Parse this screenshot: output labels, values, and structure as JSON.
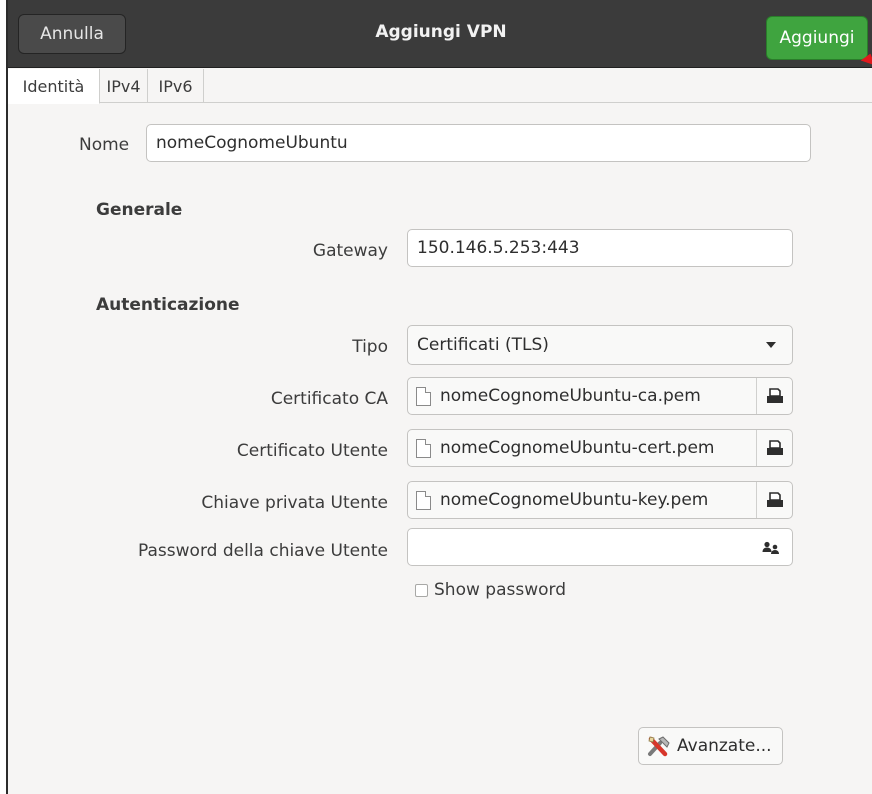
{
  "header": {
    "cancel_label": "Annulla",
    "title": "Aggiungi VPN",
    "add_label": "Aggiungi"
  },
  "tabs": [
    {
      "label": "Identità",
      "active": true
    },
    {
      "label": "IPv4",
      "active": false
    },
    {
      "label": "IPv6",
      "active": false
    }
  ],
  "identity": {
    "name_label": "Nome",
    "name_value": "nomeCognomeUbuntu"
  },
  "general": {
    "heading": "Generale",
    "gateway_label": "Gateway",
    "gateway_value": "150.146.5.253:443"
  },
  "auth": {
    "heading": "Autenticazione",
    "type_label": "Tipo",
    "type_value": "Certificati (TLS)",
    "ca_label": "Certificato CA",
    "ca_value": "nomeCognomeUbuntu-ca.pem",
    "user_cert_label": "Certificato Utente",
    "user_cert_value": "nomeCognomeUbuntu-cert.pem",
    "key_label": "Chiave privata Utente",
    "key_value": "nomeCognomeUbuntu-key.pem",
    "key_password_label": "Password della chiave Utente",
    "key_password_value": "",
    "show_password_label": "Show password",
    "show_password_checked": false
  },
  "advanced_label": "Avanzate...",
  "colors": {
    "headerbar": "#3b3b3b",
    "add_button": "#3fa43f",
    "annotation_arrow": "#e0191d"
  }
}
